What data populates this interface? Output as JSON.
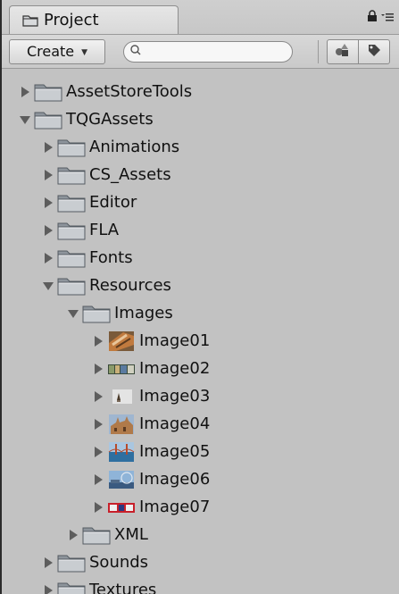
{
  "tab": {
    "title": "Project"
  },
  "toolbar": {
    "create_label": "Create",
    "search_placeholder": "",
    "search_value": ""
  },
  "icons": {
    "folder": "folder-icon",
    "lock": "lock-icon",
    "menu": "menu-icon",
    "search": "search-icon",
    "filter_type": "filter-by-type-icon",
    "filter_label": "filter-by-label-icon"
  },
  "tree": {
    "assetstoretools": "AssetStoreTools",
    "tqgassets": "TQGAssets",
    "animations": "Animations",
    "cs_assets": "CS_Assets",
    "editor": "Editor",
    "fla": "FLA",
    "fonts": "Fonts",
    "resources": "Resources",
    "images": "Images",
    "image01": "Image01",
    "image02": "Image02",
    "image03": "Image03",
    "image04": "Image04",
    "image05": "Image05",
    "image06": "Image06",
    "image07": "Image07",
    "xml": "XML",
    "sounds": "Sounds",
    "textures": "Textures"
  },
  "colors": {
    "panel_bg": "#c2c2c2",
    "folder_fill": "#b9bec3",
    "folder_dark": "#6f767d",
    "arrow": "#5d5d5d"
  }
}
